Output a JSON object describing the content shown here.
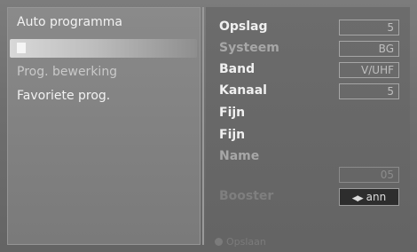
{
  "menu": {
    "items": [
      {
        "label": "Auto programma"
      },
      {
        "label": ""
      },
      {
        "label": "Prog. bewerking"
      },
      {
        "label": "Favoriete prog."
      }
    ]
  },
  "details": {
    "rows": [
      {
        "label": "Opslag",
        "value": "5"
      },
      {
        "label": "Systeem",
        "value": "BG"
      },
      {
        "label": "Band",
        "value": "V/UHF"
      },
      {
        "label": "Kanaal",
        "value": "5"
      },
      {
        "label": "Fijn"
      },
      {
        "label": "Fijn"
      },
      {
        "label": "Name"
      }
    ],
    "name_value": "05",
    "booster": {
      "label": "Booster",
      "value": "ann",
      "arrows": "◀▶"
    }
  },
  "footer": {
    "label": "Opslaan",
    "icon": "dot-icon"
  },
  "colors": {
    "background": "#6f6f6f",
    "highlight": "#d8d8d8",
    "text": "#f0f0f0"
  }
}
